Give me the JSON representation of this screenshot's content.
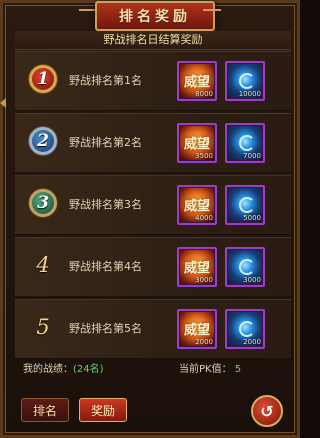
{
  "title": "排名奖励",
  "header": "野战排名日结算奖励",
  "ranks": [
    {
      "number": "1",
      "label": "野战排名第1名",
      "style": "gold",
      "items": [
        {
          "name": "威望",
          "qty": "8000"
        },
        {
          "name": "crystal",
          "qty": "10000"
        }
      ]
    },
    {
      "number": "2",
      "label": "野战排名第2名",
      "style": "blue",
      "items": [
        {
          "name": "威望",
          "qty": "3500"
        },
        {
          "name": "crystal",
          "qty": "7000"
        }
      ]
    },
    {
      "number": "3",
      "label": "野战排名第3名",
      "style": "green",
      "items": [
        {
          "name": "威望",
          "qty": "4000"
        },
        {
          "name": "crystal",
          "qty": "5000"
        }
      ]
    },
    {
      "number": "4",
      "label": "野战排名第4名",
      "style": "plain",
      "items": [
        {
          "name": "威望",
          "qty": "3000"
        },
        {
          "name": "crystal",
          "qty": "3000"
        }
      ]
    },
    {
      "number": "5",
      "label": "野战排名第5名",
      "style": "plain",
      "items": [
        {
          "name": "威望",
          "qty": "2000"
        },
        {
          "name": "crystal",
          "qty": "2000"
        }
      ]
    }
  ],
  "footer": {
    "record_label": "我的战绩：",
    "record_value": "(24名)",
    "pk_label": "当前PK值：",
    "pk_value": "5"
  },
  "buttons": {
    "rank": "排名",
    "reward": "奖励",
    "back": "↺"
  },
  "colors": {
    "accent": "#c9a15b",
    "active_tab": "#c8381f",
    "item_border": "#9a3fc4",
    "highlight_text": "#5fd36a"
  }
}
